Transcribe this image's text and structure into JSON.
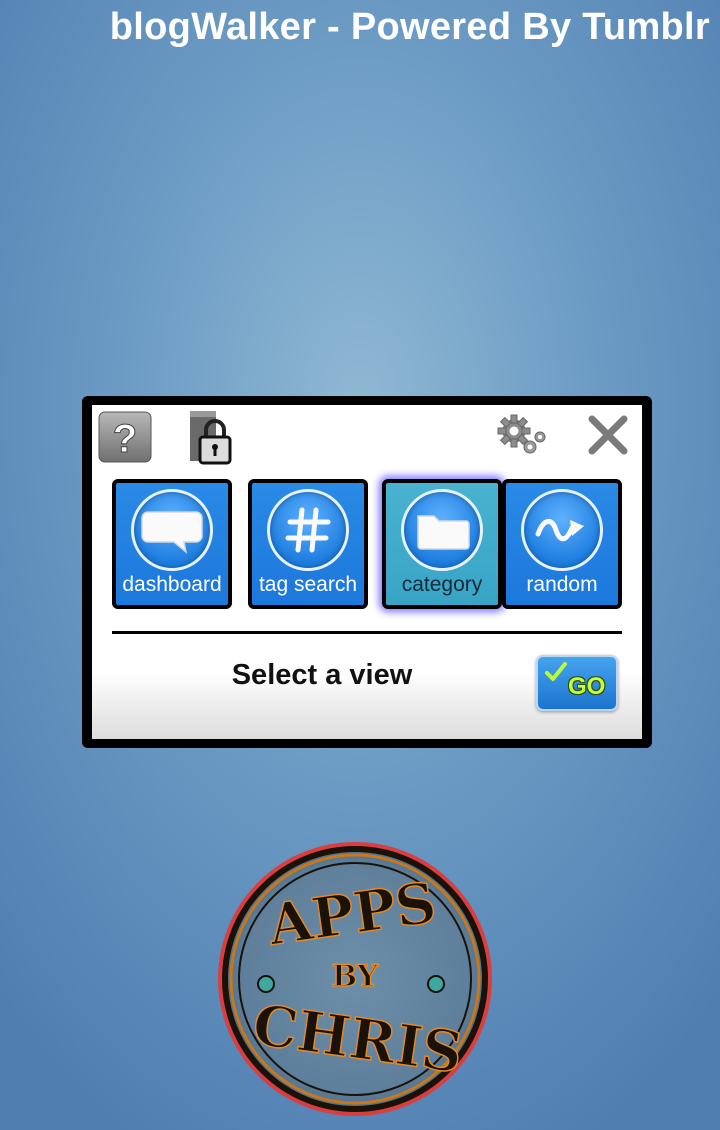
{
  "app": {
    "title": "blogWalker - Powered By Tumblr"
  },
  "toolbar": {
    "help_icon": "help-icon",
    "lock_icon": "lock-icon",
    "settings_icon": "gear-icon",
    "close_icon": "close-icon"
  },
  "views": [
    {
      "label": "dashboard",
      "icon": "speech-bubble-icon",
      "selected": false
    },
    {
      "label": "tag search",
      "icon": "hashtag-icon",
      "selected": false
    },
    {
      "label": "category",
      "icon": "folder-icon",
      "selected": true
    },
    {
      "label": "random",
      "icon": "wave-arrow-icon",
      "selected": false
    }
  ],
  "status": {
    "text": "Select a view"
  },
  "go_button": {
    "label": "GO"
  },
  "logo": {
    "text": "APPS BY CHRIS"
  },
  "colors": {
    "tile": "#1c78dc",
    "tile_selected": "#38a4c6",
    "go_text": "#c5ff3c"
  }
}
